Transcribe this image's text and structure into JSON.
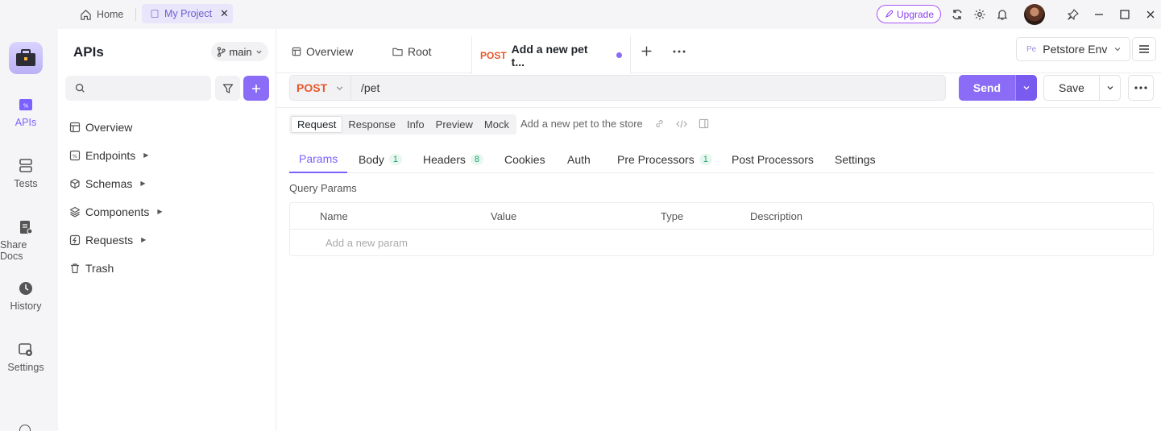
{
  "titlebar": {
    "home_label": "Home",
    "project_tab": "My Project",
    "upgrade_label": "Upgrade",
    "accent": "#8b6cf6"
  },
  "rail": {
    "items": [
      {
        "label": "APIs",
        "icon": "apis-icon",
        "active": true
      },
      {
        "label": "Tests",
        "icon": "tests-icon"
      },
      {
        "label": "Share Docs",
        "icon": "share-docs-icon"
      },
      {
        "label": "History",
        "icon": "history-icon"
      },
      {
        "label": "Settings",
        "icon": "settings-icon"
      }
    ]
  },
  "sidebar": {
    "title": "APIs",
    "branch": "main",
    "search_placeholder": "",
    "tree": [
      {
        "label": "Overview",
        "icon": "overview-icon",
        "caret": false
      },
      {
        "label": "Endpoints",
        "icon": "endpoints-icon",
        "caret": true
      },
      {
        "label": "Schemas",
        "icon": "schemas-icon",
        "caret": true
      },
      {
        "label": "Components",
        "icon": "components-icon",
        "caret": true
      },
      {
        "label": "Requests",
        "icon": "requests-icon",
        "caret": true
      },
      {
        "label": "Trash",
        "icon": "trash-icon",
        "caret": false
      }
    ]
  },
  "tabs": {
    "overview": "Overview",
    "root": "Root",
    "active_method": "POST",
    "active_title": "Add a new pet t...",
    "environment_badge": "Pe",
    "environment": "Petstore Env"
  },
  "request": {
    "method": "POST",
    "url": "/pet",
    "send_label": "Send",
    "save_label": "Save",
    "method_color": "#e8572a"
  },
  "segments": {
    "items": [
      "Request",
      "Response",
      "Info",
      "Preview",
      "Mock"
    ],
    "active": "Request",
    "description": "Add a new pet to the store"
  },
  "subtabs": {
    "params": "Params",
    "body": "Body",
    "body_count": "1",
    "headers": "Headers",
    "headers_count": "8",
    "cookies": "Cookies",
    "auth": "Auth",
    "pre": "Pre Processors",
    "pre_count": "1",
    "post": "Post Processors",
    "settings": "Settings"
  },
  "query": {
    "label": "Query Params",
    "columns": [
      "Name",
      "Value",
      "Type",
      "Description"
    ],
    "add_placeholder": "Add a new param"
  }
}
